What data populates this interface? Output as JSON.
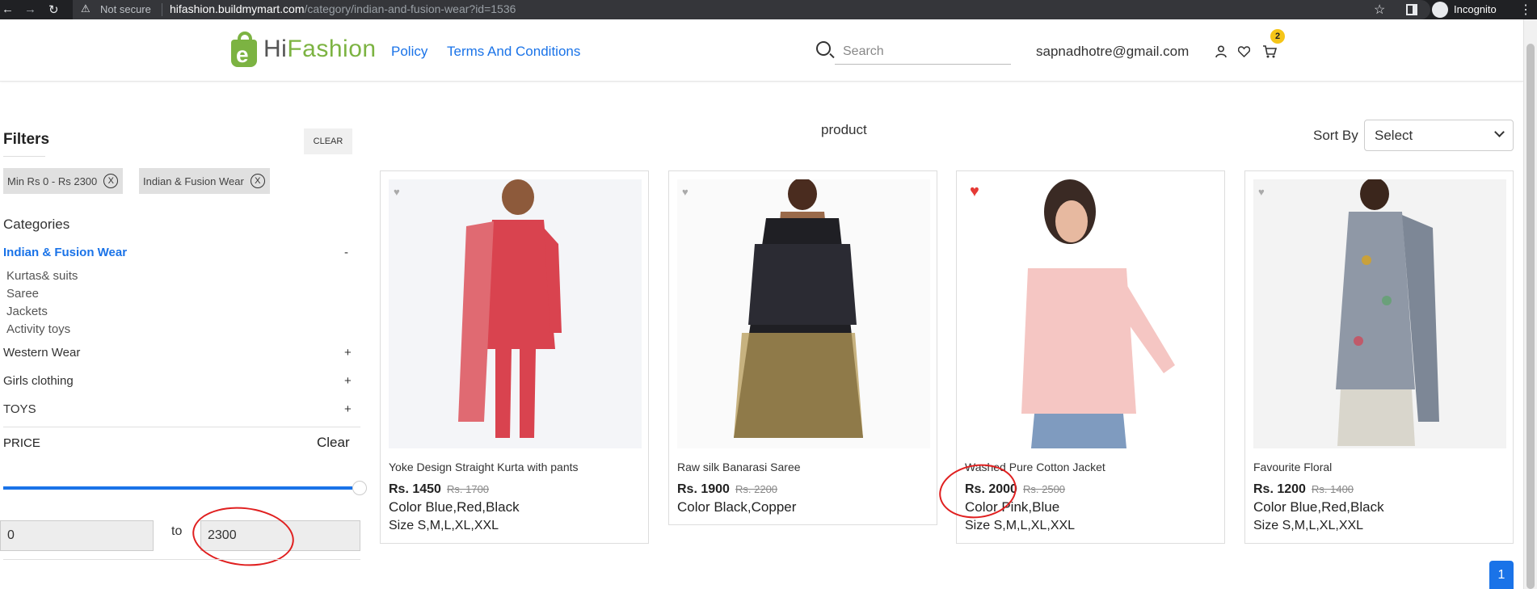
{
  "browser": {
    "security": "Not secure",
    "url_host": "hifashion.buildmymart.com",
    "url_path": "/category/indian-and-fusion-wear?id=1536",
    "profile": "Incognito"
  },
  "header": {
    "logo_mark": "e",
    "logo_hi": "Hi",
    "logo_fashion": "Fashion",
    "nav": [
      "Policy",
      "Terms And Conditions"
    ],
    "search_placeholder": "Search",
    "email": "sapnadhotre@gmail.com",
    "cart_count": "2",
    "icons": [
      "search-icon",
      "user-icon",
      "heart-icon",
      "cart-icon"
    ]
  },
  "filters": {
    "title": "Filters",
    "clear": "CLEAR",
    "chips": [
      {
        "label": "Min Rs 0 - Rs 2300",
        "remove": "X"
      },
      {
        "label": "Indian & Fusion Wear",
        "remove": "X"
      }
    ],
    "categories_title": "Categories",
    "active_category": {
      "label": "Indian & Fusion Wear",
      "toggle": "-"
    },
    "subcategories": [
      "Kurtas& suits",
      "Saree",
      "Jackets",
      "Activity toys"
    ],
    "categories": [
      {
        "label": "Western Wear",
        "toggle": "+"
      },
      {
        "label": "Girls clothing",
        "toggle": "+"
      },
      {
        "label": "TOYS",
        "toggle": "+"
      }
    ],
    "price": {
      "title": "PRICE",
      "clear": "Clear",
      "min": "0",
      "max": "2300",
      "to": "to",
      "slider_fill_fraction": 1.0
    }
  },
  "main": {
    "heading": "product",
    "sort_label": "Sort By",
    "sort_value": "Select",
    "products": [
      {
        "title": "Yoke Design Straight Kurta with pants",
        "price": "Rs. 1450",
        "mrp": "Rs. 1700",
        "color": "Color Blue,Red,Black",
        "size": "Size S,M,L,XL,XXL",
        "wishlisted": false
      },
      {
        "title": "Raw silk Banarasi Saree",
        "price": "Rs. 1900",
        "mrp": "Rs. 2200",
        "color": "Color Black,Copper",
        "size": "",
        "wishlisted": false
      },
      {
        "title": "Washed Pure Cotton Jacket",
        "price": "Rs. 2000",
        "mrp": "Rs. 2500",
        "color": "Color Pink,Blue",
        "size": "Size S,M,L,XL,XXL",
        "wishlisted": true
      },
      {
        "title": "Favourite Floral",
        "price": "Rs. 1200",
        "mrp": "Rs. 1400",
        "color": "Color Blue,Red,Black",
        "size": "Size S,M,L,XL,XXL",
        "wishlisted": false
      }
    ],
    "pagination": [
      "1"
    ]
  },
  "colors": {
    "accent": "#1a73e8",
    "brand_green": "#7cb342",
    "annotation_red": "#e02020",
    "wishlist_active": "#e53935"
  }
}
